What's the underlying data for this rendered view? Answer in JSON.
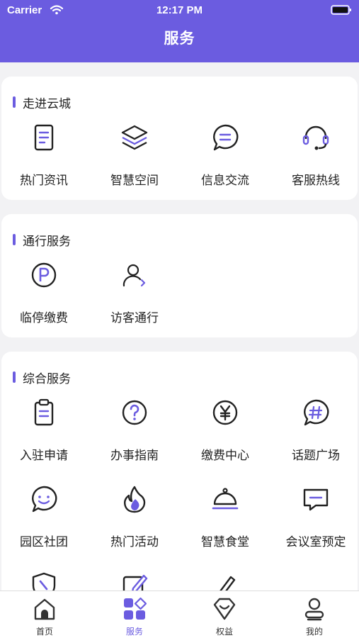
{
  "status_bar": {
    "carrier": "Carrier",
    "time": "12:17 PM"
  },
  "header": {
    "title": "服务"
  },
  "sections": [
    {
      "title": "走进云城",
      "items": [
        {
          "label": "热门资讯",
          "icon": "document-icon"
        },
        {
          "label": "智慧空间",
          "icon": "layers-icon"
        },
        {
          "label": "信息交流",
          "icon": "chat-bubble-icon"
        },
        {
          "label": "客服热线",
          "icon": "headset-icon"
        }
      ]
    },
    {
      "title": "通行服务",
      "items": [
        {
          "label": "临停缴费",
          "icon": "parking-icon"
        },
        {
          "label": "访客通行",
          "icon": "visitor-icon"
        }
      ]
    },
    {
      "title": "综合服务",
      "items": [
        {
          "label": "入驻申请",
          "icon": "clipboard-icon"
        },
        {
          "label": "办事指南",
          "icon": "question-icon"
        },
        {
          "label": "缴费中心",
          "icon": "yen-icon"
        },
        {
          "label": "话题广场",
          "icon": "hashtag-icon"
        },
        {
          "label": "园区社团",
          "icon": "smile-chat-icon"
        },
        {
          "label": "热门活动",
          "icon": "flame-icon"
        },
        {
          "label": "智慧食堂",
          "icon": "cloche-icon"
        },
        {
          "label": "会议室预定",
          "icon": "meeting-message-icon"
        }
      ]
    }
  ],
  "tabbar": [
    {
      "label": "首页",
      "icon": "home-icon",
      "active": false
    },
    {
      "label": "服务",
      "icon": "services-grid-icon",
      "active": true
    },
    {
      "label": "权益",
      "icon": "benefits-icon",
      "active": false
    },
    {
      "label": "我的",
      "icon": "profile-icon",
      "active": false
    }
  ],
  "colors": {
    "accent": "#6b5ce0",
    "background": "#f2f2f4",
    "card": "#ffffff"
  }
}
